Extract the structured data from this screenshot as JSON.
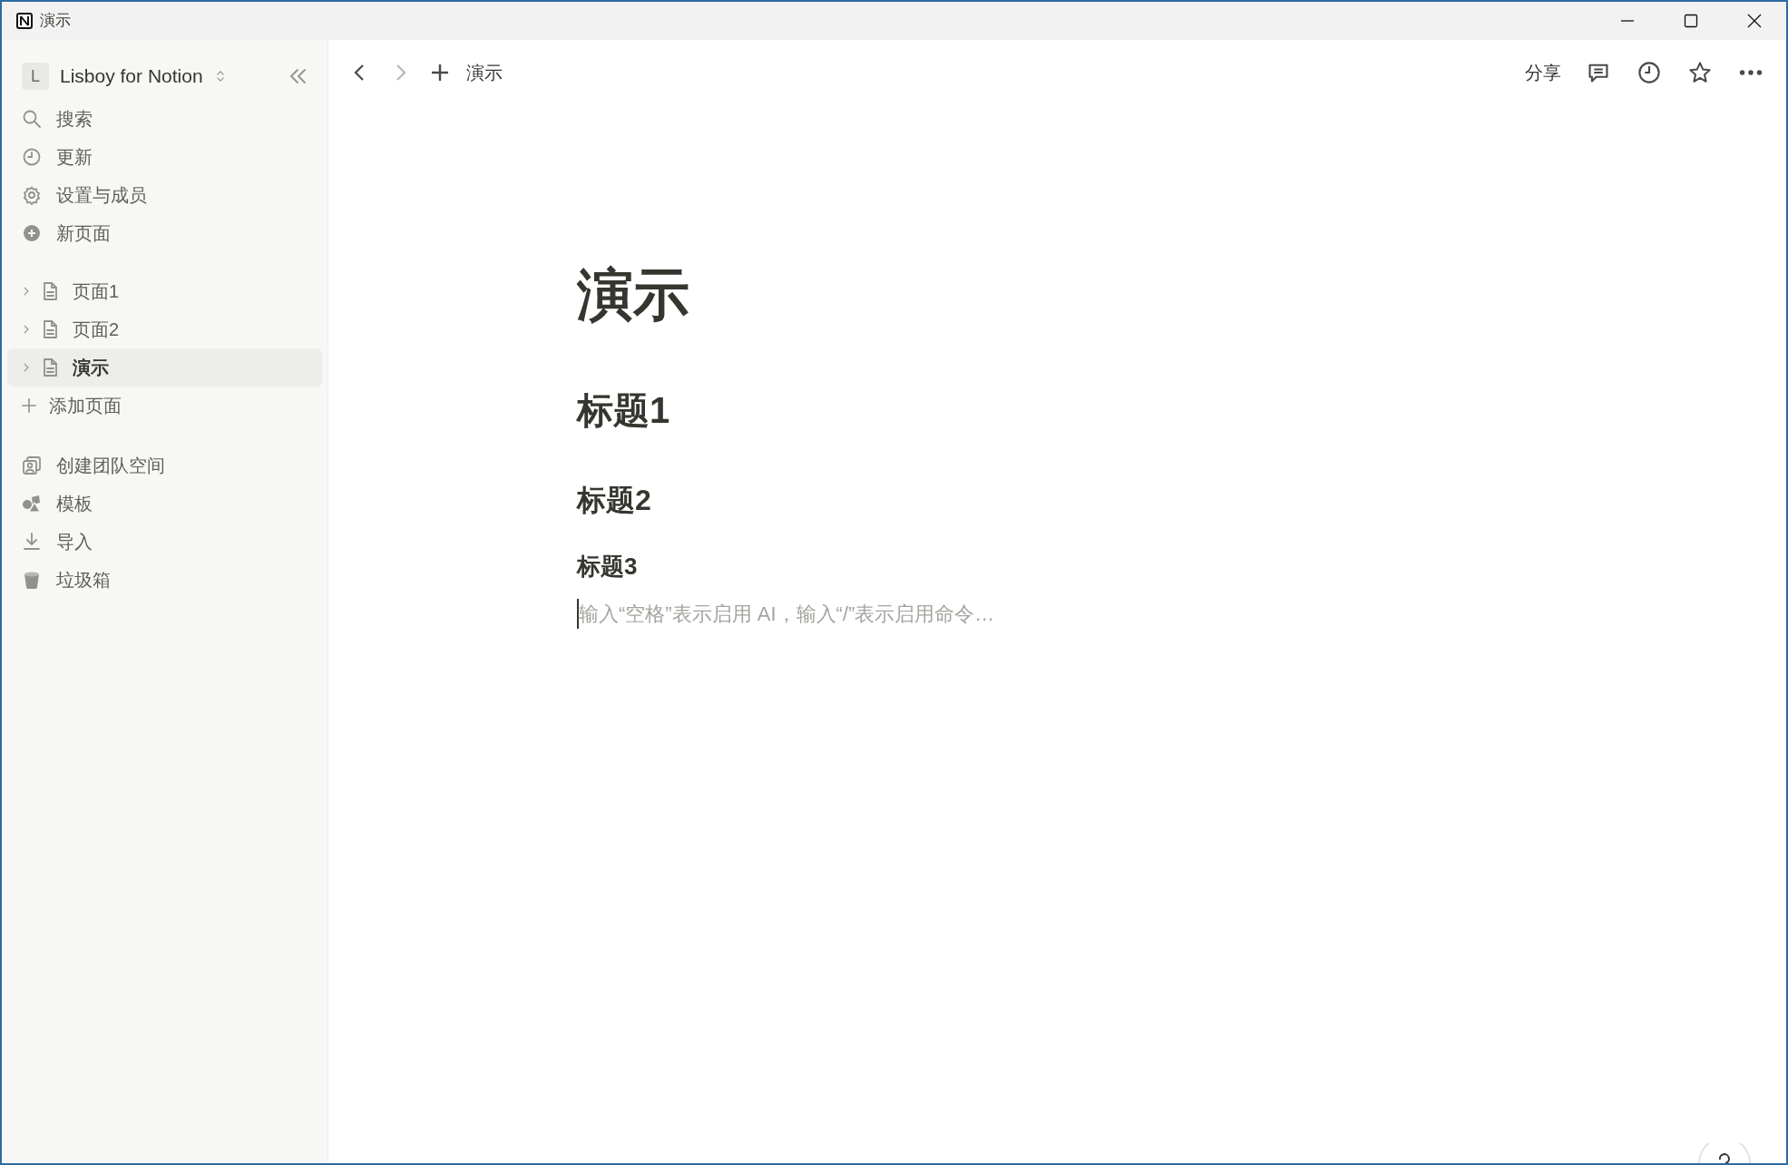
{
  "window": {
    "title": "演示"
  },
  "sidebar": {
    "workspace": {
      "initial": "L",
      "name": "Lisboy for Notion"
    },
    "actions": [
      {
        "kind": "search",
        "label": "搜索"
      },
      {
        "kind": "updates",
        "label": "更新"
      },
      {
        "kind": "settings",
        "label": "设置与成员"
      },
      {
        "kind": "new-page",
        "label": "新页面"
      }
    ],
    "pages": [
      {
        "label": "页面1",
        "selected": false
      },
      {
        "label": "页面2",
        "selected": false
      },
      {
        "label": "演示",
        "selected": true
      }
    ],
    "add_page": "添加页面",
    "tools": [
      {
        "kind": "team",
        "label": "创建团队空间"
      },
      {
        "kind": "templates",
        "label": "模板"
      },
      {
        "kind": "import",
        "label": "导入"
      },
      {
        "kind": "trash",
        "label": "垃圾箱"
      }
    ]
  },
  "topbar": {
    "forward_disabled": true,
    "breadcrumb": "演示",
    "share": "分享"
  },
  "document": {
    "title": "演示",
    "blocks": [
      {
        "kind": "h1",
        "text": "标题1"
      },
      {
        "kind": "h2",
        "text": "标题2"
      },
      {
        "kind": "h3",
        "text": "标题3"
      }
    ],
    "placeholder": "输入“空格”表示启用 AI，输入“/”表示启用命令…"
  }
}
